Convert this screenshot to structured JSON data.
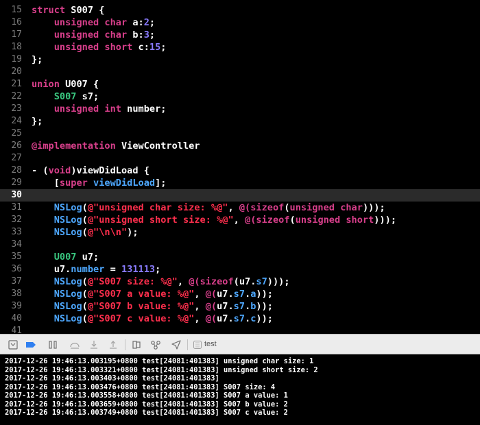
{
  "editor": {
    "current_line": "30",
    "lines": [
      {
        "num": "15",
        "tokens": [
          {
            "t": "struct",
            "c": "kw"
          },
          {
            "t": " S007 {",
            "c": "tx"
          }
        ]
      },
      {
        "num": "16",
        "tokens": [
          {
            "t": "    "
          },
          {
            "t": "unsigned",
            "c": "kw"
          },
          {
            "t": " "
          },
          {
            "t": "char",
            "c": "kw"
          },
          {
            "t": " a:",
            "c": "tx"
          },
          {
            "t": "2",
            "c": "nu"
          },
          {
            "t": ";",
            "c": "tx"
          }
        ]
      },
      {
        "num": "17",
        "tokens": [
          {
            "t": "    "
          },
          {
            "t": "unsigned",
            "c": "kw"
          },
          {
            "t": " "
          },
          {
            "t": "char",
            "c": "kw"
          },
          {
            "t": " b:",
            "c": "tx"
          },
          {
            "t": "3",
            "c": "nu"
          },
          {
            "t": ";",
            "c": "tx"
          }
        ]
      },
      {
        "num": "18",
        "tokens": [
          {
            "t": "    "
          },
          {
            "t": "unsigned",
            "c": "kw"
          },
          {
            "t": " "
          },
          {
            "t": "short",
            "c": "kw"
          },
          {
            "t": " c:",
            "c": "tx"
          },
          {
            "t": "15",
            "c": "nu"
          },
          {
            "t": ";",
            "c": "tx"
          }
        ]
      },
      {
        "num": "19",
        "tokens": [
          {
            "t": "};",
            "c": "tx"
          }
        ]
      },
      {
        "num": "20",
        "tokens": []
      },
      {
        "num": "21",
        "tokens": [
          {
            "t": "union",
            "c": "kw"
          },
          {
            "t": " U007 {",
            "c": "tx"
          }
        ]
      },
      {
        "num": "22",
        "tokens": [
          {
            "t": "    "
          },
          {
            "t": "S007",
            "c": "ty"
          },
          {
            "t": " s7;",
            "c": "tx"
          }
        ]
      },
      {
        "num": "23",
        "tokens": [
          {
            "t": "    "
          },
          {
            "t": "unsigned",
            "c": "kw"
          },
          {
            "t": " "
          },
          {
            "t": "int",
            "c": "kw"
          },
          {
            "t": " number;",
            "c": "tx"
          }
        ]
      },
      {
        "num": "24",
        "tokens": [
          {
            "t": "};",
            "c": "tx"
          }
        ]
      },
      {
        "num": "25",
        "tokens": []
      },
      {
        "num": "26",
        "tokens": [
          {
            "t": "@implementation",
            "c": "kw"
          },
          {
            "t": " ViewController",
            "c": "tx"
          }
        ]
      },
      {
        "num": "27",
        "tokens": []
      },
      {
        "num": "28",
        "tokens": [
          {
            "t": "- (",
            "c": "tx"
          },
          {
            "t": "void",
            "c": "kw"
          },
          {
            "t": ")viewDidLoad {",
            "c": "tx"
          }
        ]
      },
      {
        "num": "29",
        "tokens": [
          {
            "t": "    [",
            "c": "tx"
          },
          {
            "t": "super",
            "c": "kw"
          },
          {
            "t": " "
          },
          {
            "t": "viewDidLoad",
            "c": "fn"
          },
          {
            "t": "];",
            "c": "tx"
          }
        ]
      },
      {
        "num": "30",
        "tokens": []
      },
      {
        "num": "31",
        "tokens": [
          {
            "t": "    "
          },
          {
            "t": "NSLog",
            "c": "fn"
          },
          {
            "t": "(",
            "c": "tx"
          },
          {
            "t": "@\"unsigned char size: %@\"",
            "c": "st"
          },
          {
            "t": ", ",
            "c": "tx"
          },
          {
            "t": "@(",
            "c": "kw"
          },
          {
            "t": "sizeof",
            "c": "kw"
          },
          {
            "t": "(",
            "c": "tx"
          },
          {
            "t": "unsigned",
            "c": "kw"
          },
          {
            "t": " "
          },
          {
            "t": "char",
            "c": "kw"
          },
          {
            "t": ")));",
            "c": "tx"
          }
        ]
      },
      {
        "num": "32",
        "tokens": [
          {
            "t": "    "
          },
          {
            "t": "NSLog",
            "c": "fn"
          },
          {
            "t": "(",
            "c": "tx"
          },
          {
            "t": "@\"unsigned short size: %@\"",
            "c": "st"
          },
          {
            "t": ", ",
            "c": "tx"
          },
          {
            "t": "@(",
            "c": "kw"
          },
          {
            "t": "sizeof",
            "c": "kw"
          },
          {
            "t": "(",
            "c": "tx"
          },
          {
            "t": "unsigned",
            "c": "kw"
          },
          {
            "t": " "
          },
          {
            "t": "short",
            "c": "kw"
          },
          {
            "t": ")));",
            "c": "tx"
          }
        ]
      },
      {
        "num": "33",
        "tokens": [
          {
            "t": "    "
          },
          {
            "t": "NSLog",
            "c": "fn"
          },
          {
            "t": "(",
            "c": "tx"
          },
          {
            "t": "@\"\\n\\n\"",
            "c": "st"
          },
          {
            "t": ");",
            "c": "tx"
          }
        ]
      },
      {
        "num": "34",
        "tokens": []
      },
      {
        "num": "35",
        "tokens": [
          {
            "t": "    "
          },
          {
            "t": "U007",
            "c": "ty"
          },
          {
            "t": " u7;",
            "c": "tx"
          }
        ]
      },
      {
        "num": "36",
        "tokens": [
          {
            "t": "    u7.",
            "c": "tx"
          },
          {
            "t": "number",
            "c": "fn"
          },
          {
            "t": " = ",
            "c": "tx"
          },
          {
            "t": "131113",
            "c": "nu"
          },
          {
            "t": ";",
            "c": "tx"
          }
        ]
      },
      {
        "num": "37",
        "tokens": [
          {
            "t": "    "
          },
          {
            "t": "NSLog",
            "c": "fn"
          },
          {
            "t": "(",
            "c": "tx"
          },
          {
            "t": "@\"S007 size: %@\"",
            "c": "st"
          },
          {
            "t": ", ",
            "c": "tx"
          },
          {
            "t": "@(",
            "c": "kw"
          },
          {
            "t": "sizeof",
            "c": "kw"
          },
          {
            "t": "(u7.",
            "c": "tx"
          },
          {
            "t": "s7",
            "c": "fn"
          },
          {
            "t": ")));",
            "c": "tx"
          }
        ]
      },
      {
        "num": "38",
        "tokens": [
          {
            "t": "    "
          },
          {
            "t": "NSLog",
            "c": "fn"
          },
          {
            "t": "(",
            "c": "tx"
          },
          {
            "t": "@\"S007 a value: %@\"",
            "c": "st"
          },
          {
            "t": ", ",
            "c": "tx"
          },
          {
            "t": "@(",
            "c": "kw"
          },
          {
            "t": "u7.",
            "c": "tx"
          },
          {
            "t": "s7",
            "c": "fn"
          },
          {
            "t": ".",
            "c": "tx"
          },
          {
            "t": "a",
            "c": "fn"
          },
          {
            "t": "));",
            "c": "tx"
          }
        ]
      },
      {
        "num": "39",
        "tokens": [
          {
            "t": "    "
          },
          {
            "t": "NSLog",
            "c": "fn"
          },
          {
            "t": "(",
            "c": "tx"
          },
          {
            "t": "@\"S007 b value: %@\"",
            "c": "st"
          },
          {
            "t": ", ",
            "c": "tx"
          },
          {
            "t": "@(",
            "c": "kw"
          },
          {
            "t": "u7.",
            "c": "tx"
          },
          {
            "t": "s7",
            "c": "fn"
          },
          {
            "t": ".",
            "c": "tx"
          },
          {
            "t": "b",
            "c": "fn"
          },
          {
            "t": "));",
            "c": "tx"
          }
        ]
      },
      {
        "num": "40",
        "tokens": [
          {
            "t": "    "
          },
          {
            "t": "NSLog",
            "c": "fn"
          },
          {
            "t": "(",
            "c": "tx"
          },
          {
            "t": "@\"S007 c value: %@\"",
            "c": "st"
          },
          {
            "t": ", ",
            "c": "tx"
          },
          {
            "t": "@(",
            "c": "kw"
          },
          {
            "t": "u7.",
            "c": "tx"
          },
          {
            "t": "s7",
            "c": "fn"
          },
          {
            "t": ".",
            "c": "tx"
          },
          {
            "t": "c",
            "c": "fn"
          },
          {
            "t": "));",
            "c": "tx"
          }
        ]
      },
      {
        "num": "41",
        "tokens": []
      }
    ]
  },
  "colors": {
    "keyword": "#d83f8b",
    "type": "#39c67f",
    "function": "#4ea8ff",
    "string": "#ff2f4d",
    "number": "#8a7cff",
    "text": "#ffffff"
  },
  "debug_bar": {
    "target_label": "test",
    "buttons": [
      {
        "name": "hide-debug-area-icon"
      },
      {
        "name": "breakpoints-toggle-icon"
      },
      {
        "name": "pause-icon"
      },
      {
        "name": "step-over-icon"
      },
      {
        "name": "step-into-icon"
      },
      {
        "name": "step-out-icon"
      },
      {
        "name": "view-hierarchy-icon"
      },
      {
        "name": "memory-graph-icon"
      },
      {
        "name": "simulate-location-icon"
      },
      {
        "name": "target-app-icon"
      }
    ]
  },
  "console": {
    "lines": [
      "2017-12-26 19:46:13.003195+0800 test[24081:401383] unsigned char size: 1",
      "2017-12-26 19:46:13.003321+0800 test[24081:401383] unsigned short size: 2",
      "2017-12-26 19:46:13.003403+0800 test[24081:401383]",
      "2017-12-26 19:46:13.003476+0800 test[24081:401383] S007 size: 4",
      "2017-12-26 19:46:13.003558+0800 test[24081:401383] S007 a value: 1",
      "2017-12-26 19:46:13.003659+0800 test[24081:401383] S007 b value: 2",
      "2017-12-26 19:46:13.003749+0800 test[24081:401383] S007 c value: 2"
    ]
  }
}
